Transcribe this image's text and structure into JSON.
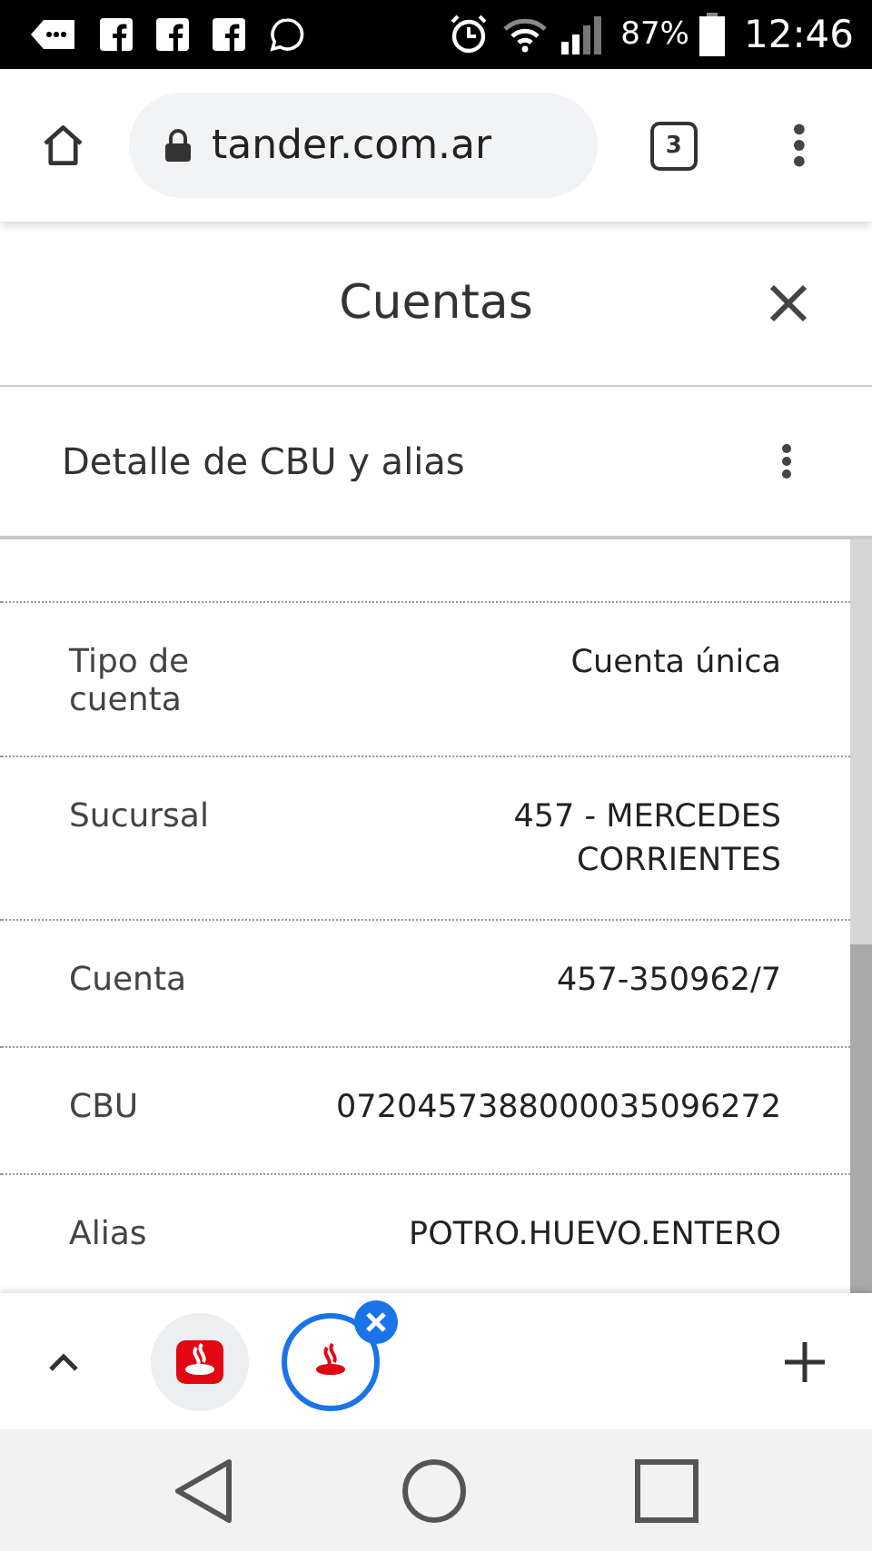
{
  "status_bar": {
    "battery": "87%",
    "time": "12:46"
  },
  "browser": {
    "url": "tander.com.ar",
    "tab_count": "3"
  },
  "panel": {
    "title": "Cuentas",
    "subtitle": "Detalle de CBU y alias",
    "rows": [
      {
        "label": "Tipo de cuenta",
        "value": "Cuenta única"
      },
      {
        "label": "Sucursal",
        "value": "457 - MERCEDES CORRIENTES"
      },
      {
        "label": "Cuenta",
        "value": "457-350962/7"
      },
      {
        "label": "CBU",
        "value": "0720457388000035096272"
      },
      {
        "label": "Alias",
        "value": "POTRO.HUEVO.ENTERO"
      }
    ]
  },
  "tab_strip": {
    "tabs": [
      {
        "selected": false
      },
      {
        "selected": true
      }
    ]
  }
}
